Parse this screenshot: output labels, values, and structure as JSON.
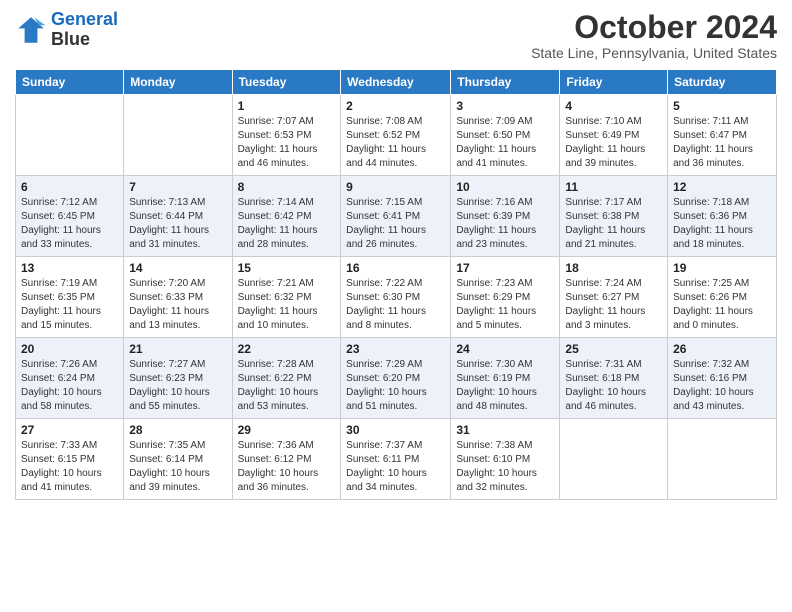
{
  "header": {
    "logo_line1": "General",
    "logo_line2": "Blue",
    "main_title": "October 2024",
    "subtitle": "State Line, Pennsylvania, United States"
  },
  "days_of_week": [
    "Sunday",
    "Monday",
    "Tuesday",
    "Wednesday",
    "Thursday",
    "Friday",
    "Saturday"
  ],
  "weeks": [
    [
      {
        "day": "",
        "sunrise": "",
        "sunset": "",
        "daylight": ""
      },
      {
        "day": "",
        "sunrise": "",
        "sunset": "",
        "daylight": ""
      },
      {
        "day": "1",
        "sunrise": "Sunrise: 7:07 AM",
        "sunset": "Sunset: 6:53 PM",
        "daylight": "Daylight: 11 hours and 46 minutes."
      },
      {
        "day": "2",
        "sunrise": "Sunrise: 7:08 AM",
        "sunset": "Sunset: 6:52 PM",
        "daylight": "Daylight: 11 hours and 44 minutes."
      },
      {
        "day": "3",
        "sunrise": "Sunrise: 7:09 AM",
        "sunset": "Sunset: 6:50 PM",
        "daylight": "Daylight: 11 hours and 41 minutes."
      },
      {
        "day": "4",
        "sunrise": "Sunrise: 7:10 AM",
        "sunset": "Sunset: 6:49 PM",
        "daylight": "Daylight: 11 hours and 39 minutes."
      },
      {
        "day": "5",
        "sunrise": "Sunrise: 7:11 AM",
        "sunset": "Sunset: 6:47 PM",
        "daylight": "Daylight: 11 hours and 36 minutes."
      }
    ],
    [
      {
        "day": "6",
        "sunrise": "Sunrise: 7:12 AM",
        "sunset": "Sunset: 6:45 PM",
        "daylight": "Daylight: 11 hours and 33 minutes."
      },
      {
        "day": "7",
        "sunrise": "Sunrise: 7:13 AM",
        "sunset": "Sunset: 6:44 PM",
        "daylight": "Daylight: 11 hours and 31 minutes."
      },
      {
        "day": "8",
        "sunrise": "Sunrise: 7:14 AM",
        "sunset": "Sunset: 6:42 PM",
        "daylight": "Daylight: 11 hours and 28 minutes."
      },
      {
        "day": "9",
        "sunrise": "Sunrise: 7:15 AM",
        "sunset": "Sunset: 6:41 PM",
        "daylight": "Daylight: 11 hours and 26 minutes."
      },
      {
        "day": "10",
        "sunrise": "Sunrise: 7:16 AM",
        "sunset": "Sunset: 6:39 PM",
        "daylight": "Daylight: 11 hours and 23 minutes."
      },
      {
        "day": "11",
        "sunrise": "Sunrise: 7:17 AM",
        "sunset": "Sunset: 6:38 PM",
        "daylight": "Daylight: 11 hours and 21 minutes."
      },
      {
        "day": "12",
        "sunrise": "Sunrise: 7:18 AM",
        "sunset": "Sunset: 6:36 PM",
        "daylight": "Daylight: 11 hours and 18 minutes."
      }
    ],
    [
      {
        "day": "13",
        "sunrise": "Sunrise: 7:19 AM",
        "sunset": "Sunset: 6:35 PM",
        "daylight": "Daylight: 11 hours and 15 minutes."
      },
      {
        "day": "14",
        "sunrise": "Sunrise: 7:20 AM",
        "sunset": "Sunset: 6:33 PM",
        "daylight": "Daylight: 11 hours and 13 minutes."
      },
      {
        "day": "15",
        "sunrise": "Sunrise: 7:21 AM",
        "sunset": "Sunset: 6:32 PM",
        "daylight": "Daylight: 11 hours and 10 minutes."
      },
      {
        "day": "16",
        "sunrise": "Sunrise: 7:22 AM",
        "sunset": "Sunset: 6:30 PM",
        "daylight": "Daylight: 11 hours and 8 minutes."
      },
      {
        "day": "17",
        "sunrise": "Sunrise: 7:23 AM",
        "sunset": "Sunset: 6:29 PM",
        "daylight": "Daylight: 11 hours and 5 minutes."
      },
      {
        "day": "18",
        "sunrise": "Sunrise: 7:24 AM",
        "sunset": "Sunset: 6:27 PM",
        "daylight": "Daylight: 11 hours and 3 minutes."
      },
      {
        "day": "19",
        "sunrise": "Sunrise: 7:25 AM",
        "sunset": "Sunset: 6:26 PM",
        "daylight": "Daylight: 11 hours and 0 minutes."
      }
    ],
    [
      {
        "day": "20",
        "sunrise": "Sunrise: 7:26 AM",
        "sunset": "Sunset: 6:24 PM",
        "daylight": "Daylight: 10 hours and 58 minutes."
      },
      {
        "day": "21",
        "sunrise": "Sunrise: 7:27 AM",
        "sunset": "Sunset: 6:23 PM",
        "daylight": "Daylight: 10 hours and 55 minutes."
      },
      {
        "day": "22",
        "sunrise": "Sunrise: 7:28 AM",
        "sunset": "Sunset: 6:22 PM",
        "daylight": "Daylight: 10 hours and 53 minutes."
      },
      {
        "day": "23",
        "sunrise": "Sunrise: 7:29 AM",
        "sunset": "Sunset: 6:20 PM",
        "daylight": "Daylight: 10 hours and 51 minutes."
      },
      {
        "day": "24",
        "sunrise": "Sunrise: 7:30 AM",
        "sunset": "Sunset: 6:19 PM",
        "daylight": "Daylight: 10 hours and 48 minutes."
      },
      {
        "day": "25",
        "sunrise": "Sunrise: 7:31 AM",
        "sunset": "Sunset: 6:18 PM",
        "daylight": "Daylight: 10 hours and 46 minutes."
      },
      {
        "day": "26",
        "sunrise": "Sunrise: 7:32 AM",
        "sunset": "Sunset: 6:16 PM",
        "daylight": "Daylight: 10 hours and 43 minutes."
      }
    ],
    [
      {
        "day": "27",
        "sunrise": "Sunrise: 7:33 AM",
        "sunset": "Sunset: 6:15 PM",
        "daylight": "Daylight: 10 hours and 41 minutes."
      },
      {
        "day": "28",
        "sunrise": "Sunrise: 7:35 AM",
        "sunset": "Sunset: 6:14 PM",
        "daylight": "Daylight: 10 hours and 39 minutes."
      },
      {
        "day": "29",
        "sunrise": "Sunrise: 7:36 AM",
        "sunset": "Sunset: 6:12 PM",
        "daylight": "Daylight: 10 hours and 36 minutes."
      },
      {
        "day": "30",
        "sunrise": "Sunrise: 7:37 AM",
        "sunset": "Sunset: 6:11 PM",
        "daylight": "Daylight: 10 hours and 34 minutes."
      },
      {
        "day": "31",
        "sunrise": "Sunrise: 7:38 AM",
        "sunset": "Sunset: 6:10 PM",
        "daylight": "Daylight: 10 hours and 32 minutes."
      },
      {
        "day": "",
        "sunrise": "",
        "sunset": "",
        "daylight": ""
      },
      {
        "day": "",
        "sunrise": "",
        "sunset": "",
        "daylight": ""
      }
    ]
  ]
}
